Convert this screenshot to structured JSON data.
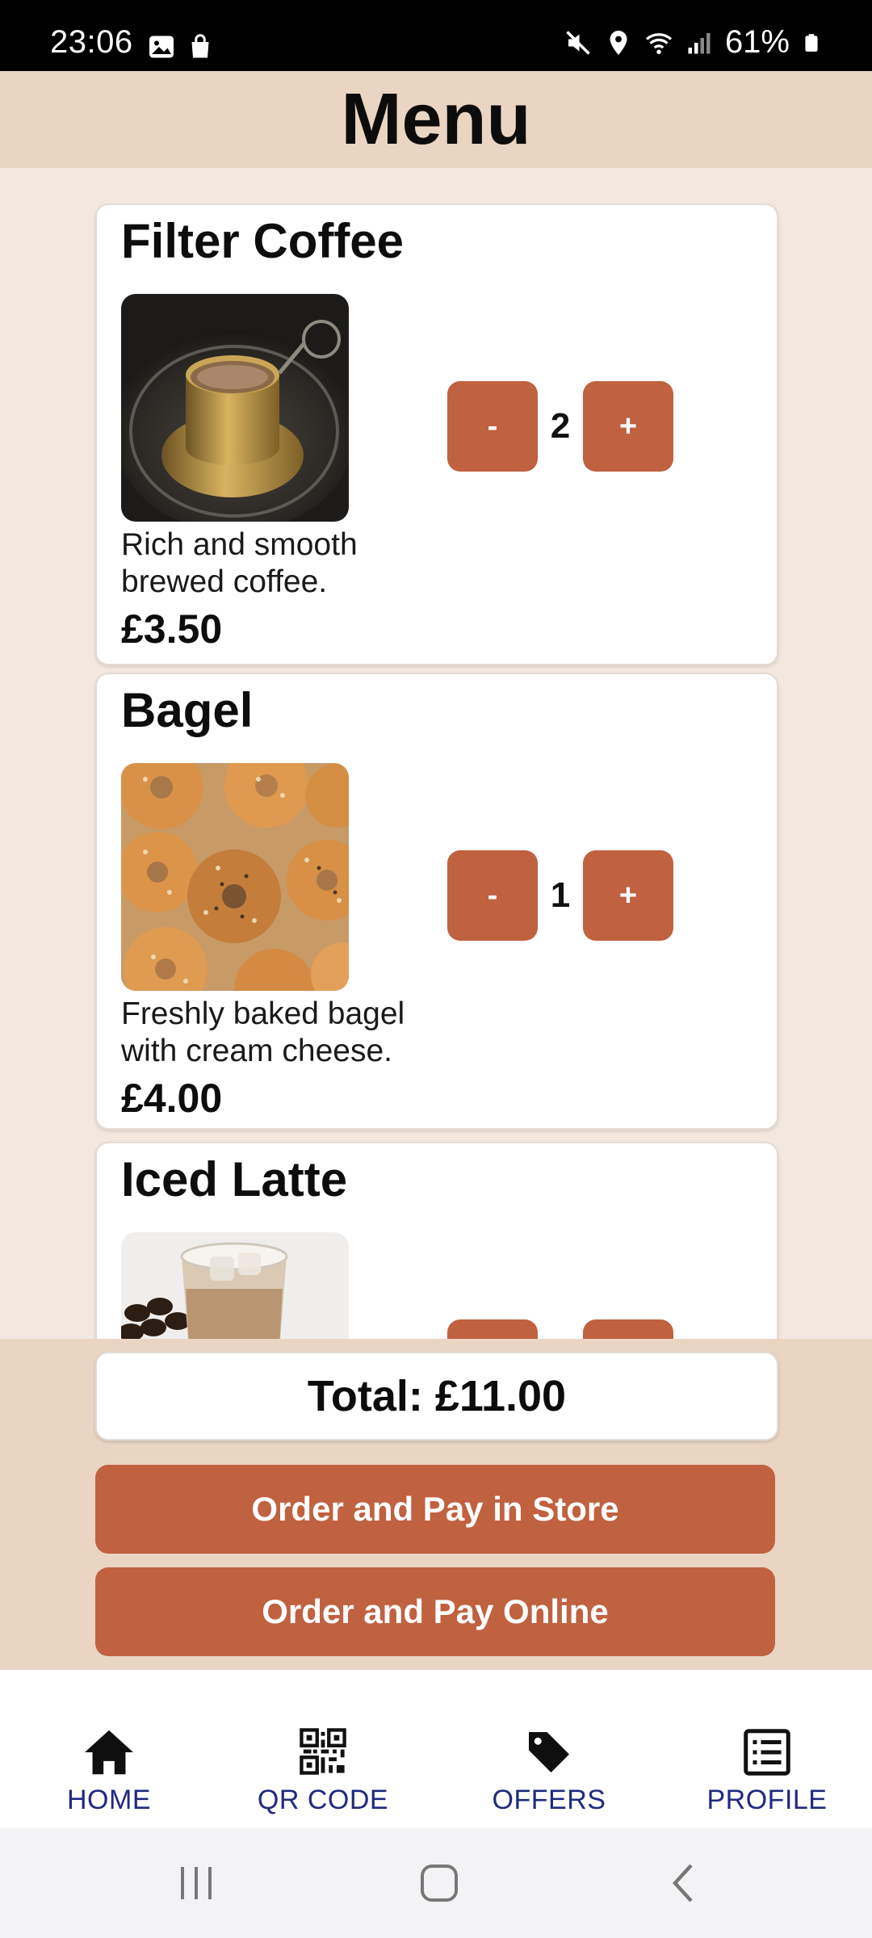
{
  "status_bar": {
    "time": "23:06",
    "battery": "61%",
    "icons_left": [
      "gallery-icon",
      "shopping-bag-icon"
    ],
    "icons_right": [
      "mute-icon",
      "location-icon",
      "wifi-icon",
      "signal-icon",
      "battery-icon"
    ]
  },
  "header": {
    "title": "Menu"
  },
  "menu_items": [
    {
      "name": "Filter Coffee",
      "description": "Rich and smooth brewed coffee.",
      "price": "£3.50",
      "quantity": "2",
      "minus_label": "-",
      "plus_label": "+"
    },
    {
      "name": "Bagel",
      "description": "Freshly baked bagel with cream cheese.",
      "price": "£4.00",
      "quantity": "1",
      "minus_label": "-",
      "plus_label": "+"
    },
    {
      "name": "Iced Latte",
      "minus_label": "-",
      "plus_label": "+"
    }
  ],
  "order": {
    "total": "Total: £11.00",
    "pay_in_store": "Order and Pay in Store",
    "pay_online": "Order and Pay Online"
  },
  "bottom_nav": [
    {
      "label": "HOME",
      "icon": "home-icon"
    },
    {
      "label": "QR CODE",
      "icon": "qr-code-icon"
    },
    {
      "label": "OFFERS",
      "icon": "tag-icon"
    },
    {
      "label": "PROFILE",
      "icon": "profile-list-icon"
    }
  ],
  "colors": {
    "accent": "#c06140",
    "header_bg": "#ead5c3",
    "page_bg": "#f3e8df",
    "nav_label": "#1f2a80"
  }
}
